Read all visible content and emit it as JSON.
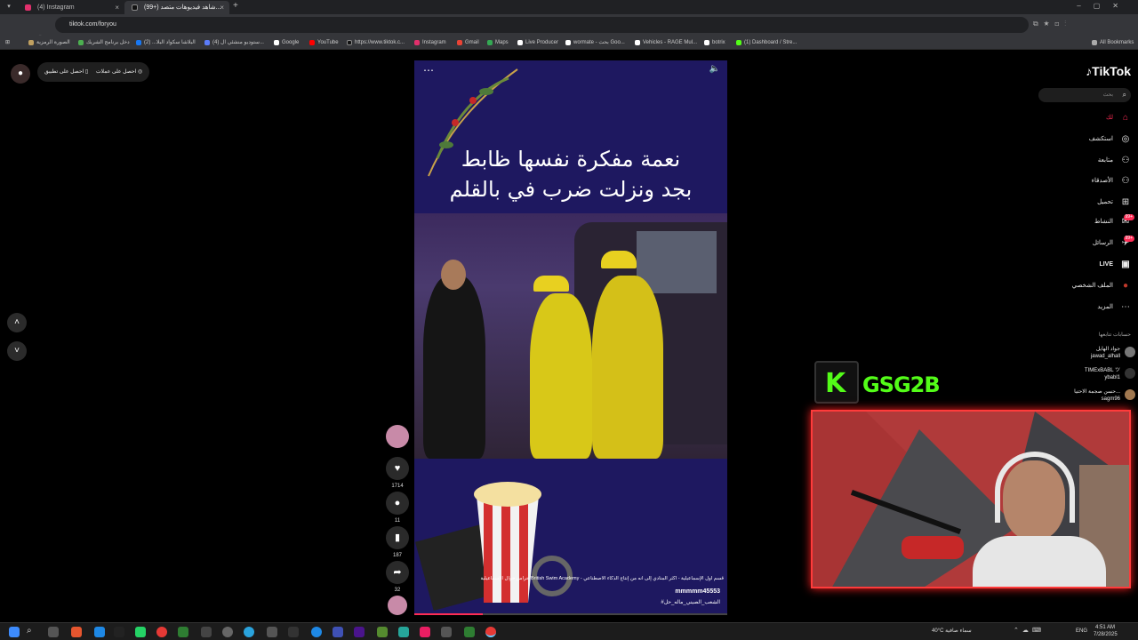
{
  "browser": {
    "tabs": [
      {
        "title": "(4) Instagram",
        "active": false,
        "color": "#e1306c"
      },
      {
        "title": "(99+) شاهد فيديوهات متصد...",
        "active": true,
        "color": "#111111"
      }
    ],
    "url": "tiktok.com/foryou",
    "bookmarks": [
      {
        "label": "الصورة الرمزية",
        "color": "#c0a060"
      },
      {
        "label": "دخل برنامج الشريك",
        "color": "#4caf50"
      },
      {
        "label": "البلاشا سكواد البلا... (2)",
        "color": "#1877f2"
      },
      {
        "label": "(4) ستوديو منشئي ال...",
        "color": "#5b7cfa"
      },
      {
        "label": "Google",
        "color": "#ffffff"
      },
      {
        "label": "YouTube",
        "color": "#ff0000"
      },
      {
        "label": "https://www.tiktok.c...",
        "color": "#111111"
      },
      {
        "label": "Instagram",
        "color": "#e1306c"
      },
      {
        "label": "Gmail",
        "color": "#ea4335"
      },
      {
        "label": "Maps",
        "color": "#34a853"
      },
      {
        "label": "Live Producer",
        "color": "#ffffff"
      },
      {
        "label": "wormate - بحث Goo...",
        "color": "#ffffff"
      },
      {
        "label": "Vehicles - RAGE Mul...",
        "color": "#ffffff"
      },
      {
        "label": "botrix",
        "color": "#ffffff"
      },
      {
        "label": "(1) Dashboard / Stre...",
        "color": "#53fc18"
      }
    ],
    "all_bookmarks": "All Bookmarks"
  },
  "topbar": {
    "get_app": "احصل على تطبيق",
    "get_coins": "احصل على عملات"
  },
  "video": {
    "headline_line1": "نعمة مفكرة نفسها ظابط",
    "headline_line2": "بجد ونزلت ضرب في بالقلم",
    "caption_line1": "حراس حوال الإسماعيلية British Swim Academy - قسم أول الإسماعيلية - أكثر المنادي إلى أنه من إنتاج الذكاء الاصطناعي",
    "username": "mmmmm45553",
    "hashtags": "#الشعب_الصيني_ماله_حل"
  },
  "actions": {
    "likes": "1714",
    "comments": "11",
    "saves": "187",
    "shares": "32"
  },
  "tiktok": {
    "logo": "TikTok",
    "search_placeholder": "بحث",
    "nav": [
      {
        "label": "لك",
        "icon": "home-icon",
        "glyph": "⌂",
        "active": true
      },
      {
        "label": "استكشف",
        "icon": "compass-icon",
        "glyph": "◎"
      },
      {
        "label": "متابعة",
        "icon": "following-icon",
        "glyph": "⚇"
      },
      {
        "label": "الأصدقاء",
        "icon": "friends-icon",
        "glyph": "⚇"
      },
      {
        "label": "تحميل",
        "icon": "upload-icon",
        "glyph": "⊞"
      },
      {
        "label": "النشاط",
        "icon": "activity-icon",
        "glyph": "✉",
        "badge": "99+"
      },
      {
        "label": "الرسائل",
        "icon": "messages-icon",
        "glyph": "✈",
        "badge": "99+"
      },
      {
        "label": "LIVE",
        "icon": "live-icon",
        "glyph": "▣"
      },
      {
        "label": "الملف الشخصي",
        "icon": "profile-icon",
        "glyph": "●"
      },
      {
        "label": "المزيد",
        "icon": "more-icon",
        "glyph": "⋯"
      }
    ],
    "following_title": "حسابات تتابعها",
    "following": [
      {
        "name": "جواد الهايل",
        "handle": "jawad_alhall"
      },
      {
        "name": "TIMExBABL ツ",
        "handle": "ybabl1"
      },
      {
        "name": "حسن صجمة الاحتيا...",
        "handle": "sagm96"
      }
    ]
  },
  "stream": {
    "overlay_name": "GSG2B",
    "accent": "#53fc18",
    "frame_color": "#ff3b3b"
  },
  "taskbar": {
    "weather": "40°C سماء صافية",
    "lang": "ENG",
    "time": "4:51 AM",
    "date": "7/28/2025"
  }
}
